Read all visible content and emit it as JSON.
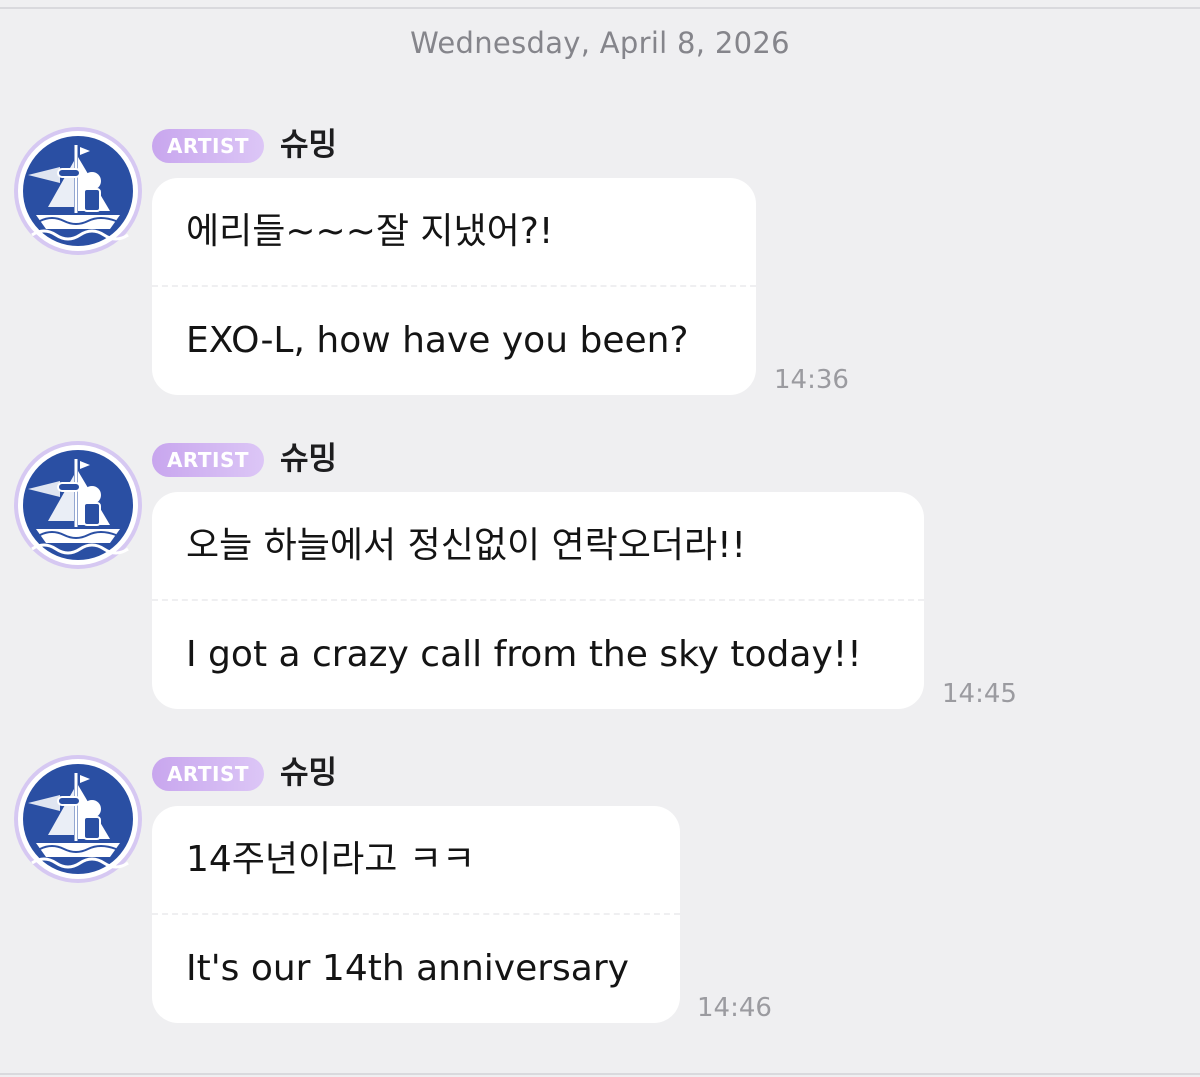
{
  "chat": {
    "date_divider": "Wednesday, April 8, 2026",
    "messages": [
      {
        "badge": "ARTIST",
        "sender": "슈밍",
        "text_ko": "에리들~~~잘 지냈어?!",
        "text_en": "EXO-L, how have you been?",
        "time": "14:36"
      },
      {
        "badge": "ARTIST",
        "sender": "슈밍",
        "text_ko": "오늘 하늘에서 정신없이 연락오더라!!",
        "text_en": "I got a crazy call from the sky today!!",
        "time": "14:45"
      },
      {
        "badge": "ARTIST",
        "sender": "슈밍",
        "text_ko": "14주년이라고 ㅋㅋ",
        "text_en": "It's our 14th anniversary",
        "time": "14:46"
      }
    ]
  },
  "avatar": {
    "icon": "sailor-ship-icon",
    "ring_color": "#d6c8f2",
    "fill_color": "#2a4fa3"
  },
  "theme": {
    "background": "#efeff1",
    "bubble": "#ffffff",
    "badge_gradient": [
      "#c8a6ee",
      "#dcc6f6"
    ]
  }
}
